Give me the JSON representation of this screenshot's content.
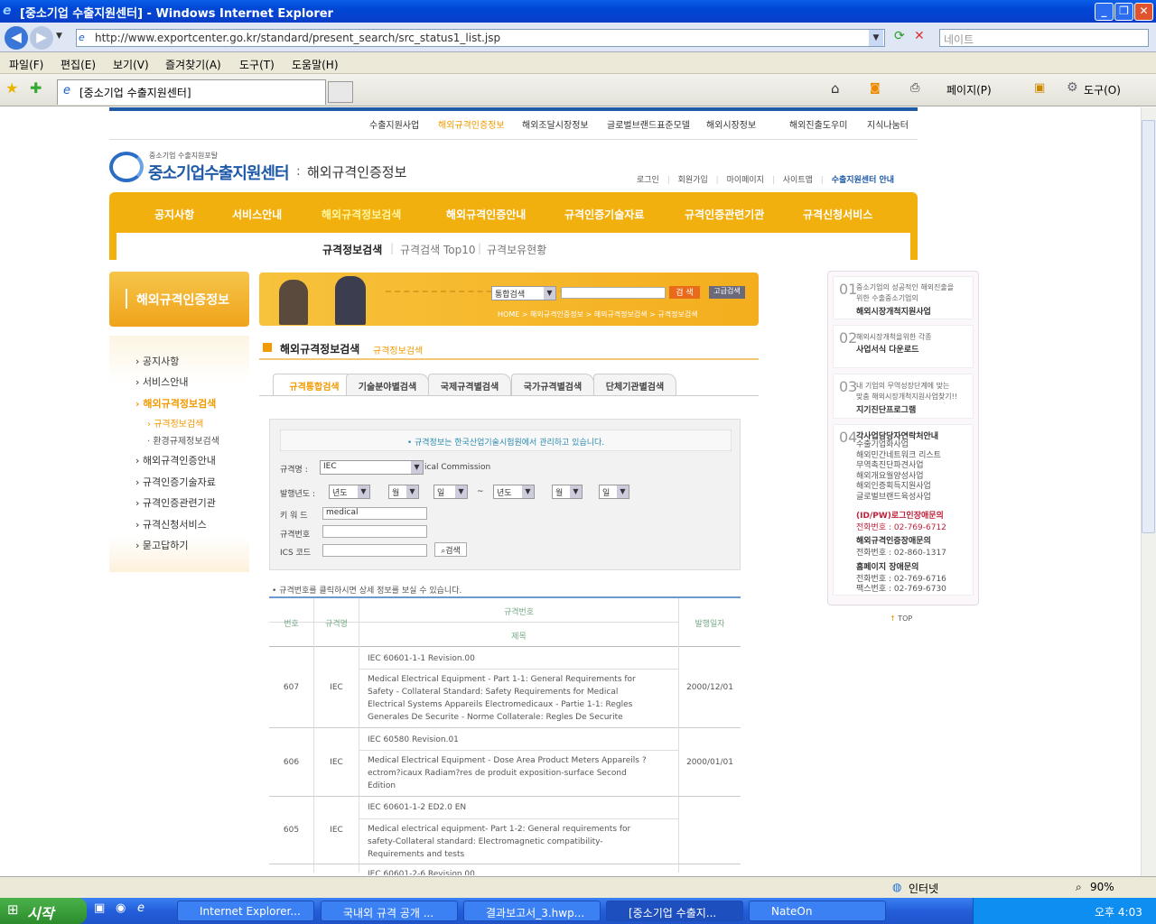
{
  "window": {
    "title": "[중소기업 수출지원센터] - Windows Internet Explorer"
  },
  "browser": {
    "address": "http://www.exportcenter.go.kr/standard/present_search/src_status1_list.jsp",
    "search_placeholder": "네이트",
    "menu": [
      "파일(F)",
      "편집(E)",
      "보기(V)",
      "즐겨찾기(A)",
      "도구(T)",
      "도움말(H)"
    ],
    "tab_title": "[중소기업 수출지원센터]",
    "cmd_page": "페이지(P)",
    "cmd_tools": "도구(O)"
  },
  "site": {
    "top_links": [
      "수출지원사업",
      "해외규격인증정보",
      "해외조달시장정보",
      "글로벌브랜드표준모델",
      "해외시장정보",
      "해외진출도우미",
      "지식나눔터"
    ],
    "logo_small": "중소기업 수출지원포탈",
    "logo_main": "중소기업수출지원센터",
    "logo_sub": "해외규격인증정보",
    "util_links": [
      "로그인",
      "회원가입",
      "마이페이지",
      "사이트맵",
      "수출지원센터 안내"
    ],
    "gnb": [
      "공지사항",
      "서비스안내",
      "해외규격정보검색",
      "해외규격인증안내",
      "규격인증기술자료",
      "규격인증관련기관",
      "규격신청서비스"
    ],
    "sub_tabs": [
      "규격정보검색",
      "규격검색 Top10",
      "규격보유현황"
    ],
    "left_banner": "해외규격인증정보",
    "lnb": [
      "공지사항",
      "서비스안내",
      "해외규격정보검색",
      "규격정보검색",
      "환경규제정보검색",
      "해외규격인증안내",
      "규격인증기술자료",
      "규격인증관련기관",
      "규격신청서비스",
      "묻고답하기"
    ],
    "header_search": {
      "select": "통합검색",
      "btn": "검 색",
      "btn2": "고급검색",
      "breadcrumb": "HOME > 해외규격인증정보 > 해외규격정보검색 > 규격정보검색"
    },
    "page_title": "해외규격정보검색",
    "page_subtitle": "규격정보검색",
    "search_tabs": [
      "규격통합검색",
      "기술분야별검색",
      "국제규격별검색",
      "국가규격별검색",
      "단체기관별검색"
    ],
    "notice": "• 규격정보는 한국산업기술시험원에서 관리하고 있습니다.",
    "form": {
      "org_label": "규격명 :",
      "org_value": "IEC",
      "org_desc": "ical Commission",
      "date_label": "발행년도 :",
      "year": "년도",
      "month": "월",
      "day": "일",
      "keyword_label": "키 워 드",
      "keyword_value": "medical",
      "number_label": "규격번호",
      "ics_label": "ICS 코드",
      "search_btn": "검색"
    },
    "hint": "• 규격번호를 클릭하시면 상세 정보를 보실 수 있습니다.",
    "table": {
      "headers": {
        "no": "번호",
        "org": "규격명",
        "code": "규격번호",
        "title": "제목",
        "date": "발행일자"
      },
      "rows": [
        {
          "no": "607",
          "org": "IEC",
          "code": "IEC 60601-1-1 Revision.00",
          "title": "Medical Electrical Equipment - Part 1-1: General Requirements for Safety - Collateral Standard: Safety Requirements for Medical Electrical Systems Appareils Electromedicaux - Partie 1-1: Regles Generales De Securite - Norme Collaterale: Regles De Securite",
          "date": "2000/12/01"
        },
        {
          "no": "606",
          "org": "IEC",
          "code": "IEC 60580 Revision.01",
          "title": "Medical Electrical Equipment - Dose Area Product Meters Appareils ?ectrom?icaux Radiam?res de produit exposition-surface Second Edition",
          "date": "2000/01/01"
        },
        {
          "no": "605",
          "org": "IEC",
          "code": "IEC 60601-1-2 ED2.0 EN",
          "title": "Medical electrical equipment- Part 1-2: General requirements for safety-Collateral standard: Electromagnetic compatibility-Requirements and tests",
          "date": ""
        },
        {
          "no": "",
          "org": "",
          "code": "IEC 60601-2-6 Revision.00",
          "title": "",
          "date": ""
        }
      ]
    },
    "right": {
      "q1a": "중소기업의 성공적인 해외진출을",
      "q1b": "위한 수출중소기업의",
      "q1c": "해외시장개척지원사업",
      "q2a": "해외시장개척을위한 각종",
      "q2b": "사업서식 다운로드",
      "q3a": "내 기업의 무역성장단계에 맞는",
      "q3b": "맞춤 해외시장개척지원사업찾기!!",
      "q3c": "지기진단프로그램",
      "q4": "각사업담당자연락처안내",
      "q4items": [
        "수출기업화사업",
        "해외민간네트워크 리스트",
        "무역촉진단파견사업",
        "해외개요월양성사업",
        "해외인증획득지원사업",
        "글로벌브랜드육성사업"
      ],
      "c1": "(ID/PW)로그인장애문의",
      "c1p": "전화번호 : 02-769-6712",
      "c2": "해외규격인증장애문의",
      "c2p": "전화번호 : 02-860-1317",
      "c3": "홈페이지 장애문의",
      "c3p": "전화번호 : 02-769-6716",
      "c3f": "팩스번호 : 02-769-6730",
      "top": "TOP"
    }
  },
  "status": {
    "zone": "인터넷",
    "zoom": "90%"
  },
  "taskbar": {
    "start": "시작",
    "tasks": [
      "Internet Explorer...",
      "국내외 규격 공개 ...",
      "결과보고서_3.hwp...",
      "[중소기업 수출지...",
      "NateOn"
    ],
    "clock": "오후 4:03"
  },
  "colors": {
    "gnb": "#f2b00e",
    "accent": "#f29a00",
    "tableline": "#6b9ad0"
  }
}
